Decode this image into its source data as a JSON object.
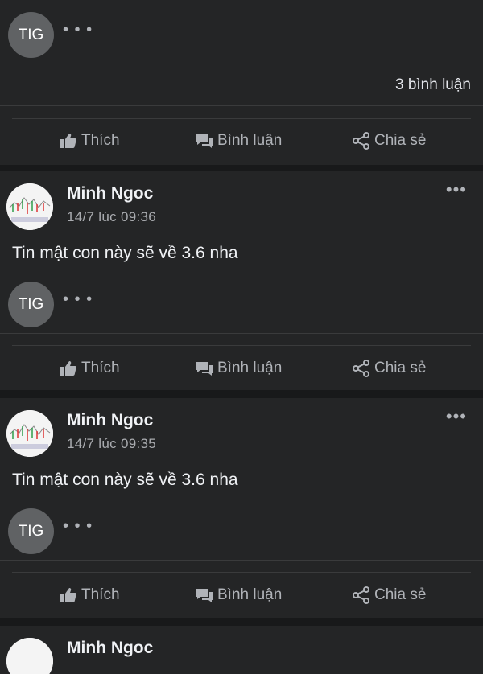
{
  "top_card": {
    "tig_label": "TIG",
    "comment_count": "3 bình luận"
  },
  "actions": {
    "like": "Thích",
    "comment": "Bình luận",
    "share": "Chia sẻ"
  },
  "posts": [
    {
      "author": "Minh Ngoc",
      "time": "14/7 lúc 09:36",
      "text": "Tin mật con này sẽ về 3.6 nha",
      "tig_label": "TIG"
    },
    {
      "author": "Minh Ngoc",
      "time": "14/7 lúc 09:35",
      "text": "Tin mật con này sẽ về 3.6 nha",
      "tig_label": "TIG"
    },
    {
      "author": "Minh Ngoc"
    }
  ],
  "icons": {
    "like": "thumbs-up-icon",
    "comment": "comment-bubble-icon",
    "share": "share-icon",
    "more": "more-options-icon"
  },
  "colors": {
    "background": "#18191a",
    "card": "#242526",
    "text_primary": "#f0f2f5",
    "text_secondary": "#b0b3b8",
    "tig_badge": "#606264"
  }
}
